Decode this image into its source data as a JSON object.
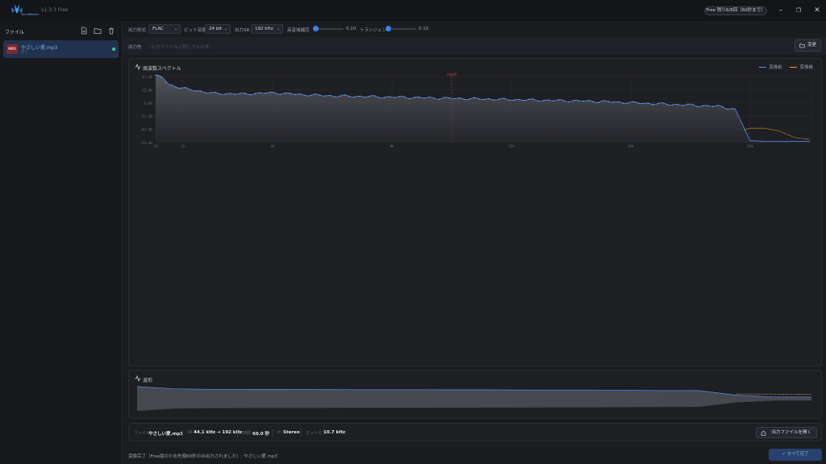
{
  "app": {
    "version": "v1.3.3 Free",
    "plan_button": "Free 残り6/8回（60秒まで）",
    "window_controls": [
      "minimize-icon",
      "maximize-icon",
      "close-icon"
    ]
  },
  "sidebar": {
    "title": "ファイル",
    "actions": [
      "add-file-icon",
      "folder-icon",
      "trash-icon"
    ],
    "files": [
      {
        "badge": "MP3",
        "name": "やさしい愛.mp3",
        "status": "完了",
        "status_color": "#3ecf8e"
      }
    ]
  },
  "toolbar": {
    "format_label": "出力形式",
    "format_value": "FLAC",
    "bitdepth_label": "ビット深度",
    "bitdepth_value": "24 bit",
    "samplerate_label": "出力SR",
    "samplerate_value": "192 kHz",
    "hf_label": "高音域補完",
    "hf_value": "0.10",
    "hf_level": 0.1,
    "transient_label": "トランジェント",
    "transient_value": "0.10",
    "transient_level": 0.1
  },
  "output": {
    "label": "出力先",
    "placeholder": "（入力ファイルと同じフォルダ）",
    "change_button": "変更"
  },
  "spectrum": {
    "title": "周波数スペクトル",
    "legend_before": "変換前",
    "legend_after": "変換後",
    "color_before": "#4f8ff7",
    "color_after": "#e0a32e"
  },
  "waveform": {
    "title": "波形"
  },
  "chart_data": [
    {
      "type": "area",
      "title": "周波数スペクトル",
      "xlabel": "",
      "ylabel": "",
      "x_ticks": [
        "20",
        "1k",
        "4k",
        "8k",
        "12k",
        "16k",
        "20k"
      ],
      "y_ticks": [
        "43 dB",
        "22 dB",
        "0 dB",
        "-21 dB",
        "-42 dB",
        "-63 dB"
      ],
      "ylim": [
        -63,
        43
      ],
      "cutoff_label": "cutoff",
      "cutoff_x": 10000,
      "series": [
        {
          "name": "変換前",
          "x": [
            20,
            300,
            500,
            1000,
            1500,
            2000,
            3000,
            4000,
            5000,
            6000,
            7000,
            8000,
            9000,
            10000,
            11000,
            12000,
            13000,
            14000,
            15000,
            16000,
            17000,
            18000,
            19000,
            19500,
            19800,
            20000,
            20500,
            21000,
            22000
          ],
          "y": [
            45,
            40,
            30,
            24,
            20,
            16,
            15,
            17,
            14,
            12,
            11,
            10,
            9,
            8,
            7,
            6,
            5,
            4,
            3,
            1,
            -1,
            -3,
            -5,
            -10,
            -40,
            -60,
            -61,
            -61,
            -61
          ]
        },
        {
          "name": "変換後",
          "x": [
            19800,
            20000,
            20500,
            21000,
            21500,
            22000
          ],
          "y": [
            -42,
            -40,
            -40,
            -45,
            -55,
            -58
          ]
        }
      ],
      "legend": "top-right",
      "grid": true
    },
    {
      "type": "area",
      "title": "波形",
      "description_series": [
        {
          "name": "envelope_before",
          "values": [
            1.0,
            0.82,
            0.78,
            0.77,
            0.77,
            0.76,
            0.75,
            0.75,
            0.74,
            0.74,
            0.73,
            0.72,
            0.72,
            0.7,
            0.68,
            0.67,
            0.3,
            0.15,
            0.15
          ]
        },
        {
          "name": "envelope_after",
          "values": [
            0.4,
            0.38,
            0.36
          ]
        }
      ]
    }
  ],
  "info": {
    "file_key": "ファイル",
    "file_value": "やさしい愛.mp3",
    "sr_key": "SR",
    "sr_value": "44.1 kHz → 192 kHz",
    "duration_key": "時間",
    "duration_value": "60.0 秒",
    "ch_key": "ch",
    "ch_value": "Stereo",
    "cutoff_key": "カットオフ",
    "cutoff_value": "10.7 kHz",
    "open_button": "出力ファイルを開く"
  },
  "status": {
    "text": "変換完了（Free版のため先頭60秒のみ出力されました）: やさしい愛.mp3",
    "done_button": "すべて完了"
  }
}
